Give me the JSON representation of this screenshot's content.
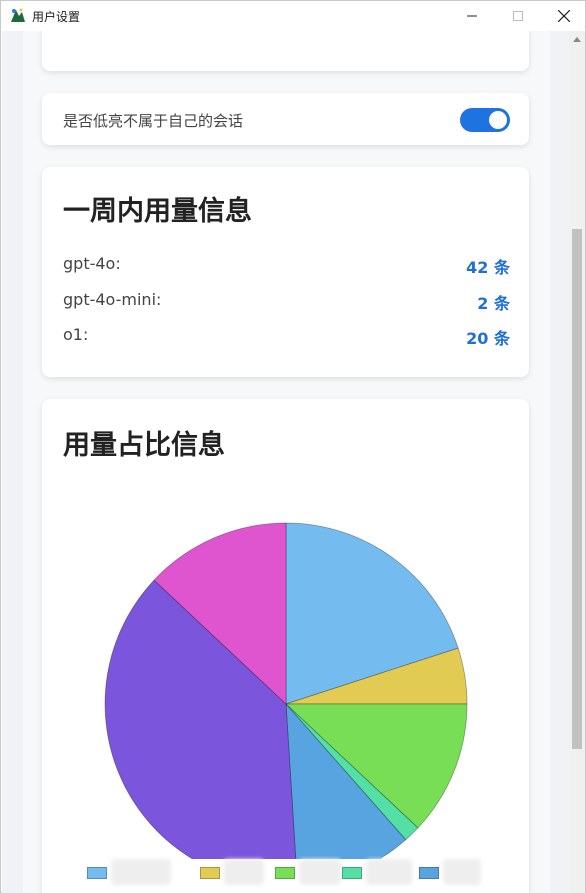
{
  "window": {
    "title": "用户设置"
  },
  "settings": {
    "top_card_text": "·   ·   ·   ·",
    "toggle": {
      "label": "是否低亮不属于自己的会话",
      "on": true,
      "color": "#1f73e0"
    }
  },
  "usage": {
    "title": "一周内用量信息",
    "rows": [
      {
        "model": "gpt-4o:",
        "count": "42 条"
      },
      {
        "model": "gpt-4o-mini:",
        "count": "2 条"
      },
      {
        "model": "o1:",
        "count": "20 条"
      }
    ]
  },
  "share": {
    "title": "用量占比信息"
  },
  "chart_data": {
    "type": "pie",
    "title": "用量占比信息",
    "slices": [
      {
        "value": 20.0,
        "color": "#74bcf0"
      },
      {
        "value": 5.0,
        "color": "#e2cb52"
      },
      {
        "value": 12.0,
        "color": "#78de55"
      },
      {
        "value": 1.5,
        "color": "#54dfa6"
      },
      {
        "value": 10.5,
        "color": "#57a4e0"
      },
      {
        "value": 38.0,
        "color": "#7b55dc"
      },
      {
        "value": 13.0,
        "color": "#df55cf"
      }
    ],
    "legend_placement": "bottom",
    "legend": [
      {
        "label": "",
        "color": "#74bcf0"
      },
      {
        "label": "",
        "color": "#e2cb52"
      },
      {
        "label": "",
        "color": "#78de55"
      },
      {
        "label": "",
        "color": "#54dfa6"
      },
      {
        "label": "",
        "color": "#57a4e0"
      }
    ]
  }
}
